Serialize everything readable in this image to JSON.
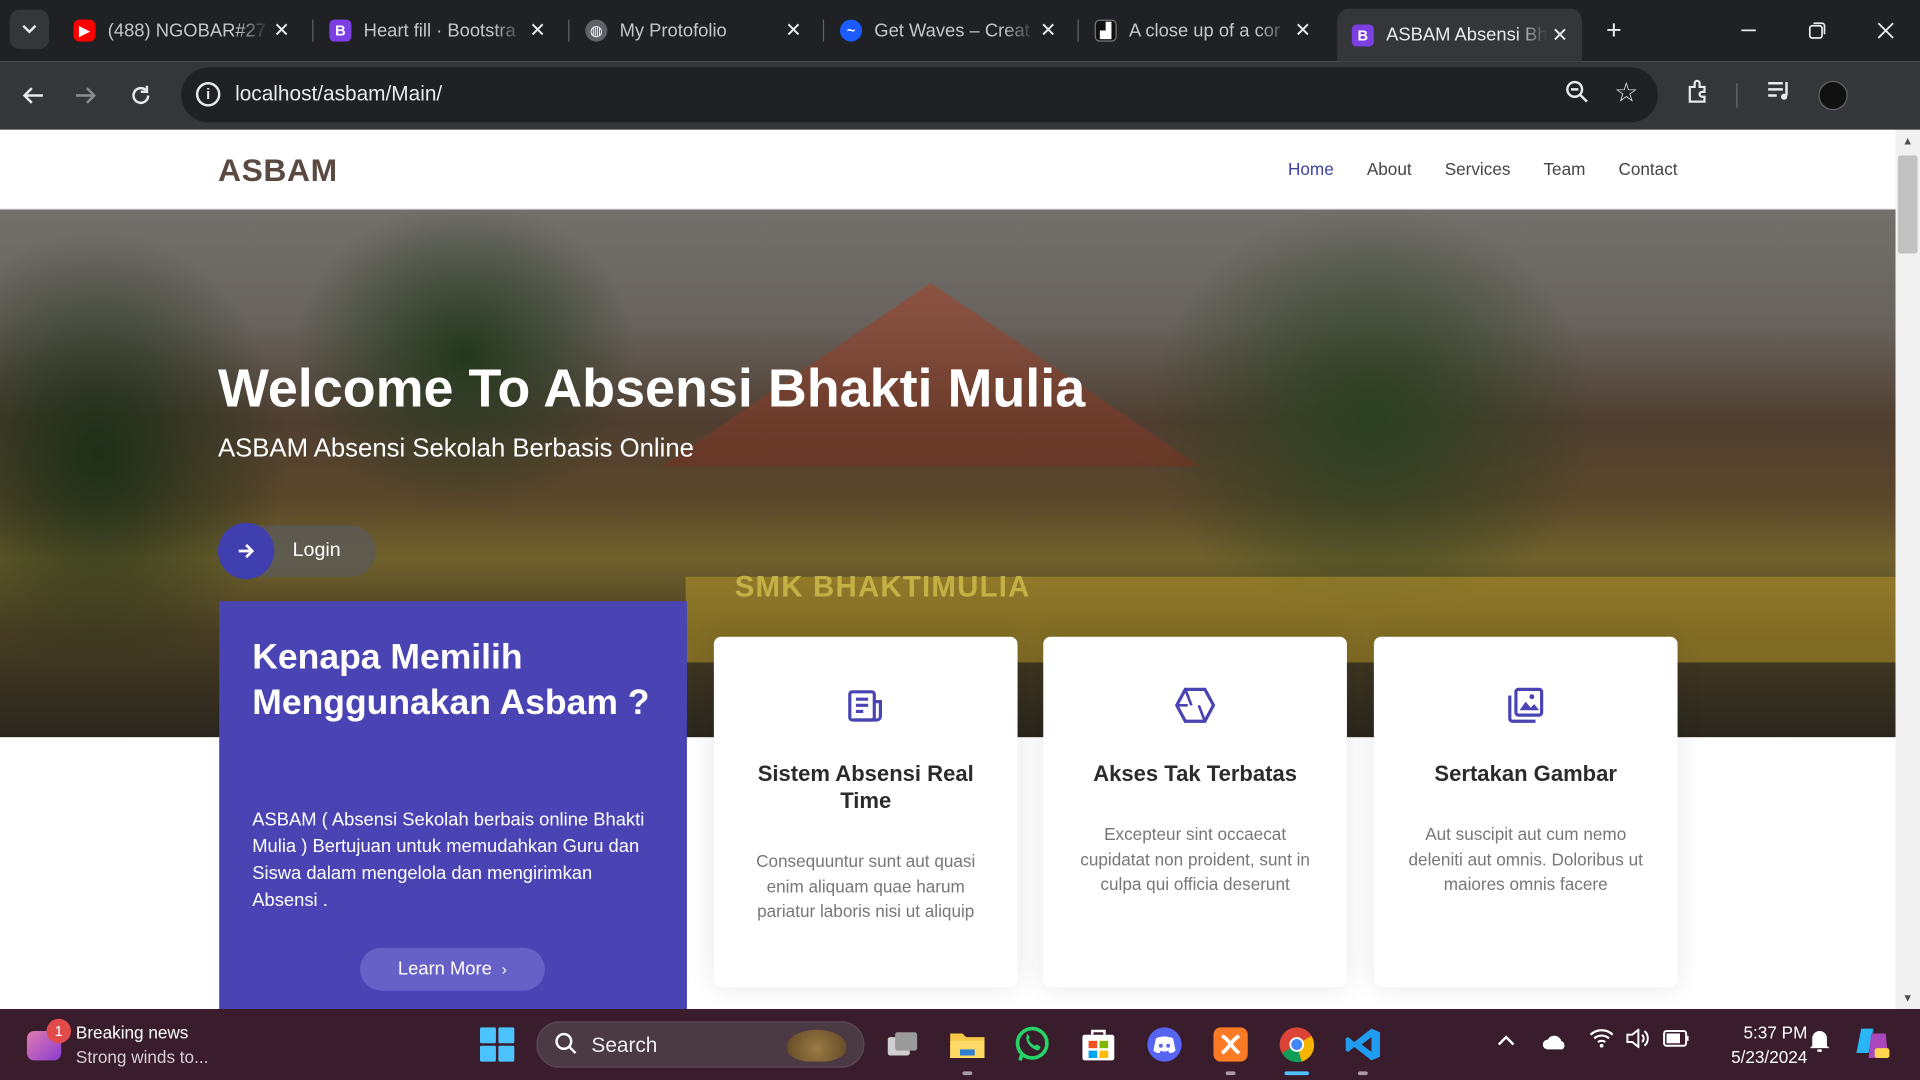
{
  "browser": {
    "tabs": [
      {
        "title": "(488) NGOBAR#27",
        "favicon": "youtube-icon"
      },
      {
        "title": "Heart fill · Bootstra",
        "favicon": "bootstrap-icon"
      },
      {
        "title": "My Protofolio",
        "favicon": "globe-icon"
      },
      {
        "title": "Get Waves – Creat",
        "favicon": "waves-icon"
      },
      {
        "title": "A close up of a cor",
        "favicon": "image-icon"
      },
      {
        "title": "ASBAM Absensi Bh",
        "favicon": "bootstrap-icon",
        "active": true
      }
    ],
    "url": "localhost/asbam/Main/"
  },
  "site": {
    "logo": "ASBAM",
    "nav": [
      {
        "label": "Home",
        "active": true
      },
      {
        "label": "About"
      },
      {
        "label": "Services"
      },
      {
        "label": "Team"
      },
      {
        "label": "Contact"
      }
    ],
    "hero": {
      "title": "Welcome To Absensi Bhakti Mulia",
      "subtitle": "ASBAM Absensi Sekolah Berbasis Online",
      "login_label": "Login",
      "sign_text": "SMK BHAKTIMULIA"
    },
    "why": {
      "heading": "Kenapa Memilih Menggunakan Asbam ?",
      "body": "ASBAM ( Absensi Sekolah berbais online Bhakti Mulia ) Bertujuan untuk memudahkan Guru dan Siswa dalam mengelola dan mengirimkan Absensi .",
      "button": "Learn More"
    },
    "cards": [
      {
        "icon": "newspaper-icon",
        "title": "Sistem Absensi Real Time",
        "text": "Consequuntur sunt aut quasi enim aliquam quae harum pariatur laboris nisi ut aliquip"
      },
      {
        "icon": "hexagon-icon",
        "title": "Akses Tak Terbatas",
        "text": "Excepteur sint occaecat cupidatat non proident, sunt in culpa qui officia deserunt"
      },
      {
        "icon": "images-icon",
        "title": "Sertakan Gambar",
        "text": "Aut suscipit aut cum nemo deleniti aut omnis. Doloribus ut maiores omnis facere"
      }
    ]
  },
  "taskbar": {
    "news_badge": "1",
    "news_title": "Breaking news",
    "news_sub": "Strong winds to...",
    "search_label": "Search",
    "time": "5:37 PM",
    "date": "5/23/2024"
  },
  "colors": {
    "accent": "#4a43b3",
    "nav_active": "#3e42a0",
    "taskbar": "#3a1d2c"
  }
}
